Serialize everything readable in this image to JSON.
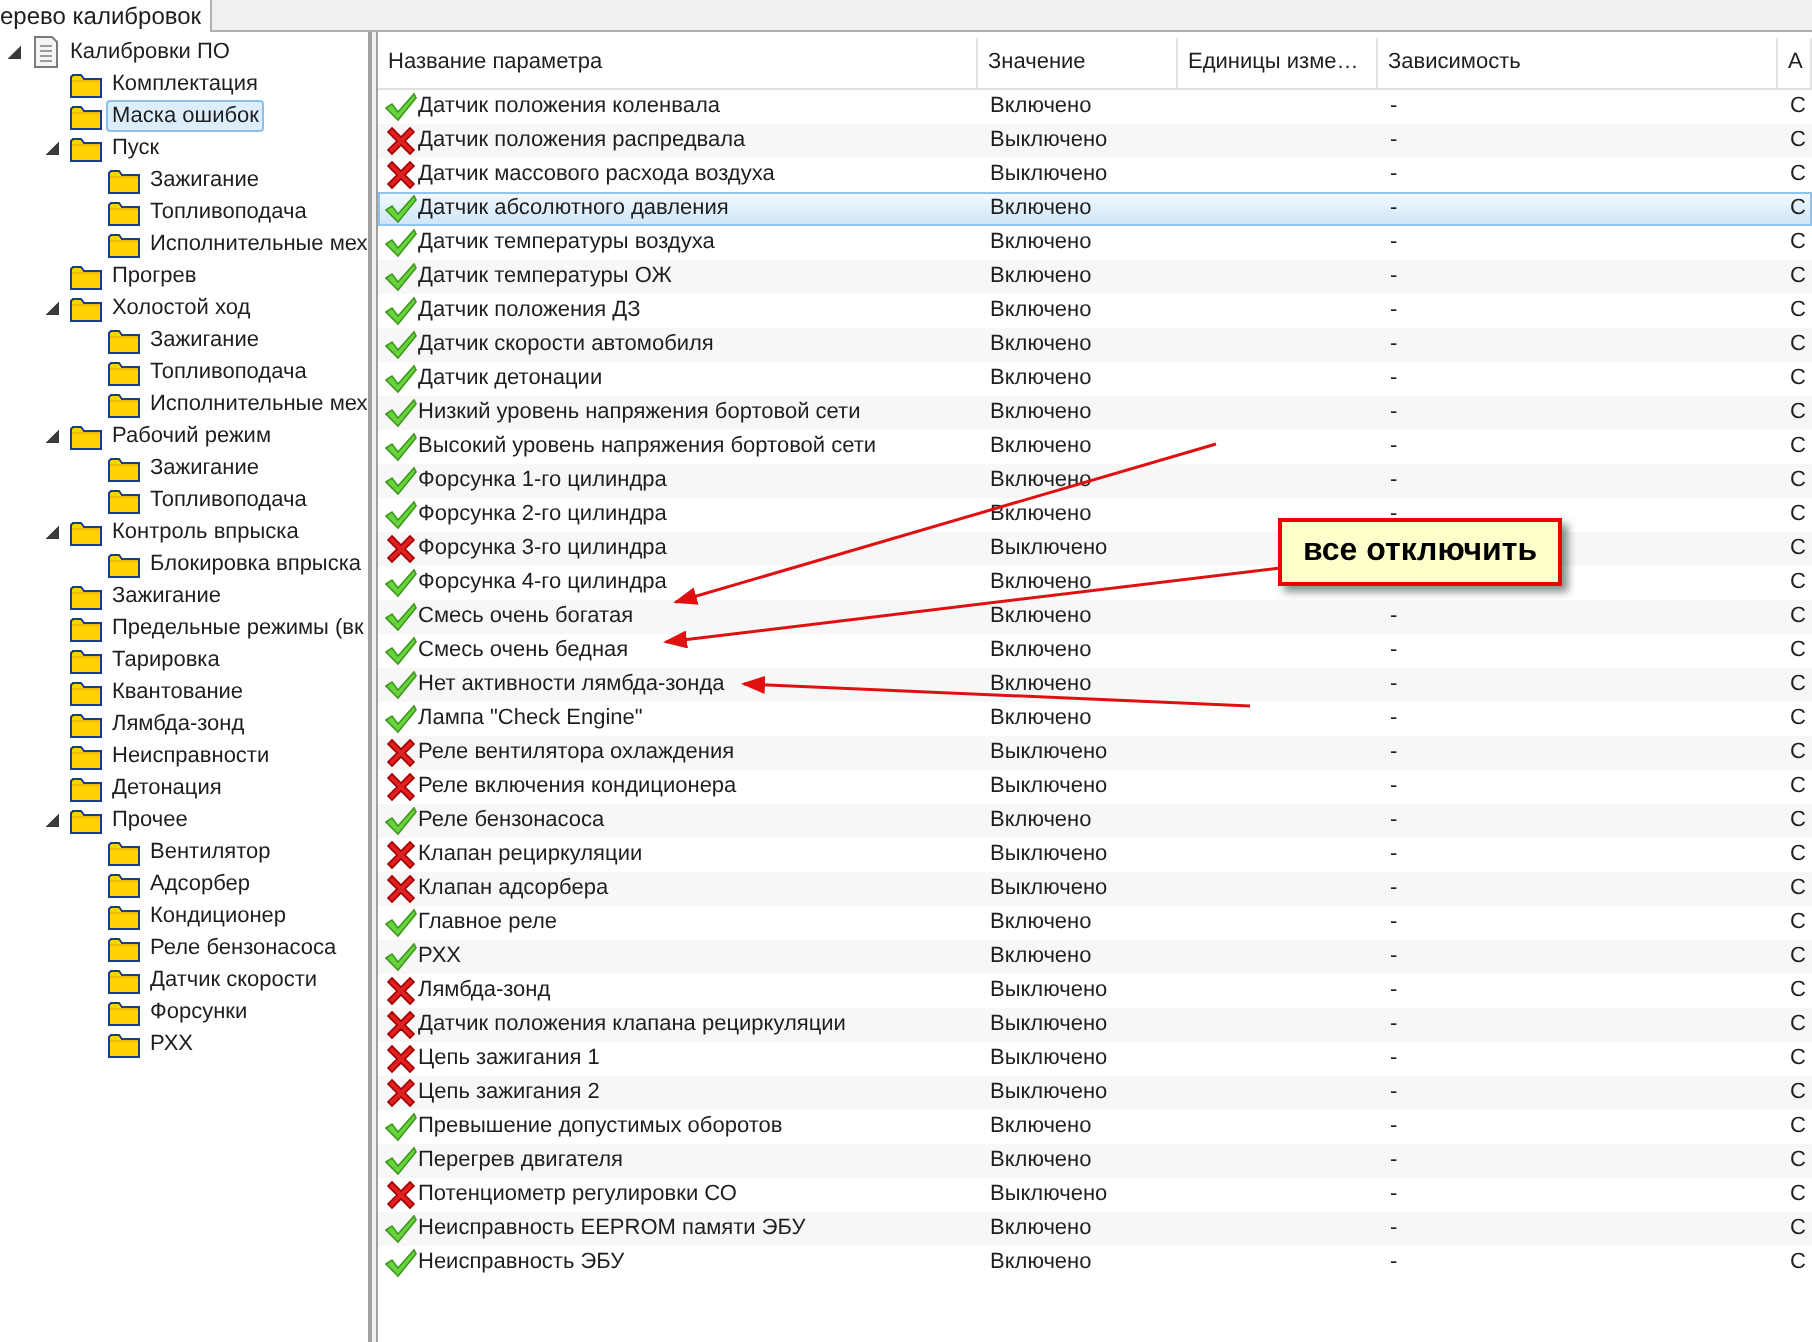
{
  "tab": {
    "label": "ерево калибровок",
    "selected": true
  },
  "tree": [
    {
      "label": "Калибровки ПО",
      "kind": "document",
      "expanded": true,
      "selected": false,
      "children": [
        {
          "label": "Комплектация",
          "kind": "folder",
          "selected": false
        },
        {
          "label": "Маска ошибок",
          "kind": "folder",
          "selected": true
        },
        {
          "label": "Пуск",
          "kind": "folder",
          "expanded": true,
          "selected": false,
          "children": [
            {
              "label": "Зажигание",
              "kind": "folder",
              "selected": false
            },
            {
              "label": "Топливоподача",
              "kind": "folder",
              "selected": false
            },
            {
              "label": "Исполнительные мех",
              "kind": "folder",
              "selected": false
            }
          ]
        },
        {
          "label": "Прогрев",
          "kind": "folder",
          "selected": false
        },
        {
          "label": "Холостой ход",
          "kind": "folder",
          "expanded": true,
          "selected": false,
          "children": [
            {
              "label": "Зажигание",
              "kind": "folder",
              "selected": false
            },
            {
              "label": "Топливоподача",
              "kind": "folder",
              "selected": false
            },
            {
              "label": "Исполнительные мех",
              "kind": "folder",
              "selected": false
            }
          ]
        },
        {
          "label": "Рабочий режим",
          "kind": "folder",
          "expanded": true,
          "selected": false,
          "children": [
            {
              "label": "Зажигание",
              "kind": "folder",
              "selected": false
            },
            {
              "label": "Топливоподача",
              "kind": "folder",
              "selected": false
            }
          ]
        },
        {
          "label": "Контроль впрыска",
          "kind": "folder",
          "expanded": true,
          "selected": false,
          "children": [
            {
              "label": "Блокировка впрыска",
              "kind": "folder",
              "selected": false
            }
          ]
        },
        {
          "label": "Зажигание",
          "kind": "folder",
          "selected": false
        },
        {
          "label": "Предельные режимы (вк",
          "kind": "folder",
          "selected": false
        },
        {
          "label": "Тарировка",
          "kind": "folder",
          "selected": false
        },
        {
          "label": "Квантование",
          "kind": "folder",
          "selected": false
        },
        {
          "label": "Лямбда-зонд",
          "kind": "folder",
          "selected": false
        },
        {
          "label": "Неисправности",
          "kind": "folder",
          "selected": false
        },
        {
          "label": "Детонация",
          "kind": "folder",
          "selected": false
        },
        {
          "label": "Прочее",
          "kind": "folder",
          "expanded": true,
          "selected": false,
          "children": [
            {
              "label": "Вентилятор",
              "kind": "folder",
              "selected": false
            },
            {
              "label": "Адсорбер",
              "kind": "folder",
              "selected": false
            },
            {
              "label": "Кондиционер",
              "kind": "folder",
              "selected": false
            },
            {
              "label": "Реле бензонасоса",
              "kind": "folder",
              "selected": false
            },
            {
              "label": "Датчик скорости",
              "kind": "folder",
              "selected": false
            },
            {
              "label": "Форсунки",
              "kind": "folder",
              "selected": false
            },
            {
              "label": "РХХ",
              "kind": "folder",
              "selected": false
            }
          ]
        }
      ]
    }
  ],
  "table": {
    "columns": [
      "Название параметра",
      "Значение",
      "Единицы изме…",
      "Зависимость",
      "А"
    ],
    "rows": [
      {
        "name": "Датчик положения коленвала",
        "enabled": true,
        "value": "Включено",
        "dependency": "-",
        "column_5": "C",
        "selected": false
      },
      {
        "name": "Датчик положения распредвала",
        "enabled": false,
        "value": "Выключено",
        "dependency": "-",
        "column_5": "C",
        "selected": false
      },
      {
        "name": "Датчик массового расхода воздуха",
        "enabled": false,
        "value": "Выключено",
        "dependency": "-",
        "column_5": "C",
        "selected": false
      },
      {
        "name": "Датчик абсолютного давления",
        "enabled": true,
        "value": "Включено",
        "dependency": "-",
        "column_5": "C",
        "selected": true
      },
      {
        "name": "Датчик температуры воздуха",
        "enabled": true,
        "value": "Включено",
        "dependency": "-",
        "column_5": "C",
        "selected": false
      },
      {
        "name": "Датчик температуры ОЖ",
        "enabled": true,
        "value": "Включено",
        "dependency": "-",
        "column_5": "C",
        "selected": false
      },
      {
        "name": "Датчик положения ДЗ",
        "enabled": true,
        "value": "Включено",
        "dependency": "-",
        "column_5": "C",
        "selected": false
      },
      {
        "name": "Датчик скорости автомобиля",
        "enabled": true,
        "value": "Включено",
        "dependency": "-",
        "column_5": "C",
        "selected": false
      },
      {
        "name": "Датчик детонации",
        "enabled": true,
        "value": "Включено",
        "dependency": "-",
        "column_5": "C",
        "selected": false
      },
      {
        "name": "Низкий уровень напряжения бортовой сети",
        "enabled": true,
        "value": "Включено",
        "dependency": "-",
        "column_5": "C",
        "selected": false
      },
      {
        "name": "Высокий уровень напряжения бортовой сети",
        "enabled": true,
        "value": "Включено",
        "dependency": "-",
        "column_5": "C",
        "selected": false
      },
      {
        "name": "Форсунка 1-го цилиндра",
        "enabled": true,
        "value": "Включено",
        "dependency": "-",
        "column_5": "C",
        "selected": false
      },
      {
        "name": "Форсунка 2-го цилиндра",
        "enabled": true,
        "value": "Включено",
        "dependency": "-",
        "column_5": "C",
        "selected": false
      },
      {
        "name": "Форсунка 3-го цилиндра",
        "enabled": false,
        "value": "Выключено",
        "column_5": "C",
        "selected": false
      },
      {
        "name": "Форсунка 4-го цилиндра",
        "enabled": true,
        "value": "Включено",
        "column_5": "C",
        "selected": false
      },
      {
        "name": "Смесь очень богатая",
        "enabled": true,
        "value": "Включено",
        "dependency": "-",
        "column_5": "C",
        "selected": false
      },
      {
        "name": "Смесь очень бедная",
        "enabled": true,
        "value": "Включено",
        "dependency": "-",
        "column_5": "C",
        "selected": false
      },
      {
        "name": "Нет активности лямбда-зонда",
        "enabled": true,
        "value": "Включено",
        "dependency": "-",
        "column_5": "C",
        "selected": false
      },
      {
        "name": "Лампа \"Check Engine\"",
        "enabled": true,
        "value": "Включено",
        "dependency": "-",
        "column_5": "C",
        "selected": false
      },
      {
        "name": "Реле вентилятора охлаждения",
        "enabled": false,
        "value": "Выключено",
        "dependency": "-",
        "column_5": "C",
        "selected": false
      },
      {
        "name": "Реле включения кондиционера",
        "enabled": false,
        "value": "Выключено",
        "dependency": "-",
        "column_5": "C",
        "selected": false
      },
      {
        "name": "Реле бензонасоса",
        "enabled": true,
        "value": "Включено",
        "dependency": "-",
        "column_5": "C",
        "selected": false
      },
      {
        "name": "Клапан рециркуляции",
        "enabled": false,
        "value": "Выключено",
        "dependency": "-",
        "column_5": "C",
        "selected": false
      },
      {
        "name": "Клапан адсорбера",
        "enabled": false,
        "value": "Выключено",
        "dependency": "-",
        "column_5": "C",
        "selected": false
      },
      {
        "name": "Главное реле",
        "enabled": true,
        "value": "Включено",
        "dependency": "-",
        "column_5": "C",
        "selected": false
      },
      {
        "name": "РХХ",
        "enabled": true,
        "value": "Включено",
        "dependency": "-",
        "column_5": "C",
        "selected": false
      },
      {
        "name": "Лямбда-зонд",
        "enabled": false,
        "value": "Выключено",
        "dependency": "-",
        "column_5": "C",
        "selected": false
      },
      {
        "name": "Датчик положения клапана рециркуляции",
        "enabled": false,
        "value": "Выключено",
        "dependency": "-",
        "column_5": "C",
        "selected": false
      },
      {
        "name": "Цепь зажигания 1",
        "enabled": false,
        "value": "Выключено",
        "dependency": "-",
        "column_5": "C",
        "selected": false
      },
      {
        "name": "Цепь зажигания 2",
        "enabled": false,
        "value": "Выключено",
        "dependency": "-",
        "column_5": "C",
        "selected": false
      },
      {
        "name": "Превышение допустимых оборотов",
        "enabled": true,
        "value": "Включено",
        "dependency": "-",
        "column_5": "C",
        "selected": false
      },
      {
        "name": "Перегрев двигателя",
        "enabled": true,
        "value": "Включено",
        "dependency": "-",
        "column_5": "C",
        "selected": false
      },
      {
        "name": "Потенциометр регулировки СО",
        "enabled": false,
        "value": "Выключено",
        "dependency": "-",
        "column_5": "C",
        "selected": false
      },
      {
        "name": "Неисправность EEPROM памяти ЭБУ",
        "enabled": true,
        "value": "Включено",
        "dependency": "-",
        "column_5": "C",
        "selected": false
      },
      {
        "name": "Неисправность ЭБУ",
        "enabled": true,
        "value": "Включено",
        "dependency": "-",
        "column_5": "C",
        "selected": false
      }
    ]
  },
  "annotation": {
    "label": "все отключить"
  }
}
